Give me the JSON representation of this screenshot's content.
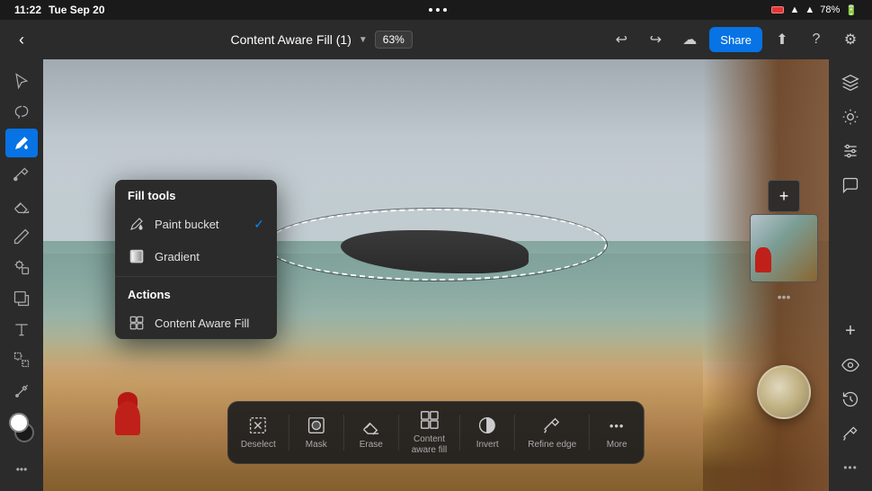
{
  "statusBar": {
    "time": "11:22",
    "date": "Tue Sep 20",
    "dots": [
      "•",
      "•",
      "•"
    ],
    "battery": "78%"
  },
  "topToolbar": {
    "title": "Content Aware Fill (1)",
    "zoom": "63%",
    "shareLabel": "Share",
    "undoTitle": "Undo",
    "redoTitle": "Redo",
    "cloudTitle": "Cloud",
    "helpTitle": "Help",
    "settingsTitle": "Settings"
  },
  "panel": {
    "fillToolsHeader": "Fill tools",
    "paintBucketLabel": "Paint bucket",
    "gradientLabel": "Gradient",
    "actionsHeader": "Actions",
    "contentAwareFillLabel": "Content Aware Fill",
    "paintBucketChecked": true
  },
  "bottomToolbar": {
    "tools": [
      {
        "id": "deselect",
        "label": "Deselect",
        "icon": "⊡"
      },
      {
        "id": "mask",
        "label": "Mask",
        "icon": "▥"
      },
      {
        "id": "erase",
        "label": "Erase",
        "icon": "◻"
      },
      {
        "id": "content-aware-fill",
        "label": "Content\naware fill",
        "icon": "⊞"
      },
      {
        "id": "invert",
        "label": "Invert",
        "icon": "⊙"
      },
      {
        "id": "refine-edge",
        "label": "Refine edge",
        "icon": "✒"
      },
      {
        "id": "more",
        "label": "More",
        "icon": "•••"
      }
    ]
  },
  "leftTools": [
    {
      "id": "selection",
      "icon": "arrow",
      "active": false
    },
    {
      "id": "lasso",
      "icon": "lasso",
      "active": false
    },
    {
      "id": "fill",
      "icon": "fill",
      "active": true
    },
    {
      "id": "brush",
      "icon": "brush",
      "active": false
    },
    {
      "id": "eraser",
      "icon": "eraser",
      "active": false
    },
    {
      "id": "pencil",
      "icon": "pencil",
      "active": false
    },
    {
      "id": "clone",
      "icon": "clone",
      "active": false
    },
    {
      "id": "transform",
      "icon": "transform",
      "active": false
    },
    {
      "id": "text",
      "icon": "text",
      "active": false
    },
    {
      "id": "smart-select",
      "icon": "smart",
      "active": false
    },
    {
      "id": "eyedropper",
      "icon": "eyedrop",
      "active": false
    }
  ],
  "rightTools": [
    {
      "id": "layers",
      "icon": "layers"
    },
    {
      "id": "properties",
      "icon": "properties"
    },
    {
      "id": "adjustments",
      "icon": "adjustments"
    },
    {
      "id": "comments",
      "icon": "comments"
    },
    {
      "id": "add",
      "icon": "add"
    },
    {
      "id": "visibility",
      "icon": "eye"
    },
    {
      "id": "history",
      "icon": "history"
    },
    {
      "id": "brush-props",
      "icon": "brush"
    }
  ]
}
